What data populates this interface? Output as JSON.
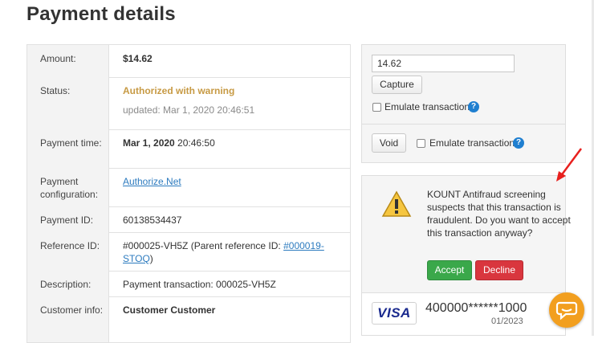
{
  "page": {
    "title": "Payment details"
  },
  "details": [
    {
      "label": "Amount:",
      "value": "$14.62"
    },
    {
      "label": "Status:",
      "status": "Authorized with warning",
      "updated": "updated: Mar 1, 2020 20:46:51"
    },
    {
      "label": "Payment time:",
      "date": "Mar 1, 2020",
      "time": " 20:46:50"
    },
    {
      "label": "Payment configuration:",
      "value": "Authorize.Net"
    },
    {
      "label": "Payment ID:",
      "value": "60138534437"
    },
    {
      "label": "Reference ID:",
      "prefix": "#000025-VH5Z (Parent reference ID: ",
      "link": "#000019-STOQ",
      "suffix": ")"
    },
    {
      "label": "Description:",
      "value": "Payment transaction: 000025-VH5Z"
    },
    {
      "label": "Customer info:",
      "value": "Customer Customer"
    }
  ],
  "capture": {
    "amount_value": "14.62",
    "capture_label": "Capture",
    "emulate_label": "Emulate transaction"
  },
  "void": {
    "void_label": "Void",
    "emulate_label": "Emulate transaction"
  },
  "fraud": {
    "message": "KOUNT Antifraud screening suspects that this transaction is fraudulent. Do you want to accept this transaction anyway?",
    "accept_label": "Accept",
    "decline_label": "Decline"
  },
  "card": {
    "brand": "VISA",
    "number": "400000******1000",
    "expiry": "01/2023"
  },
  "colors": {
    "warning": "#c79a44",
    "accept": "#3aa84a",
    "decline": "#d9363e",
    "help": "#1f7fd0",
    "chat": "#f29f1f",
    "annotation_arrow": "#e8201e"
  },
  "icons": [
    "warning-icon",
    "help-icon",
    "chat-icon",
    "arrow-annotation-icon"
  ]
}
